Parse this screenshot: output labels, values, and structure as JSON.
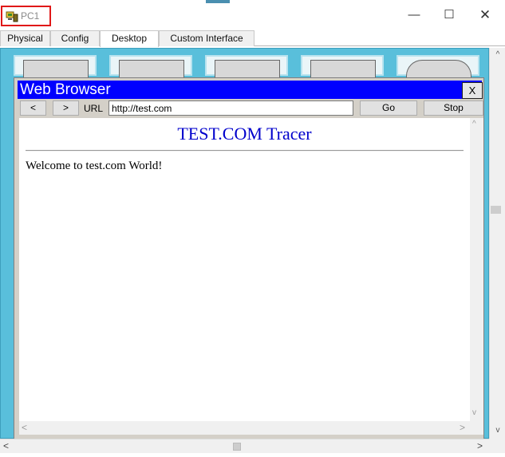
{
  "window": {
    "title": "PC1",
    "min_symbol": "—",
    "max_symbol": "☐",
    "close_symbol": "✕"
  },
  "tabs": [
    {
      "label": "Physical",
      "active": false
    },
    {
      "label": "Config",
      "active": false
    },
    {
      "label": "Desktop",
      "active": true
    },
    {
      "label": "Custom Interface",
      "active": false
    }
  ],
  "browser": {
    "title": "Web Browser",
    "close_label": "X",
    "back_label": "<",
    "forward_label": ">",
    "url_label": "URL",
    "url_value": "http://test.com",
    "go_label": "Go",
    "stop_label": "Stop",
    "page": {
      "heading": "TEST.COM Tracer",
      "body_text": "Welcome to test.com World!"
    }
  },
  "scroll": {
    "up": "^",
    "down": "v",
    "left": "<",
    "right": ">"
  },
  "colors": {
    "desktop_bg": "#59bfdb",
    "browser_titlebar": "#0000ff",
    "heading_color": "#0000cc",
    "highlight_box": "#e01818"
  },
  "icons": [
    "pc-icon",
    "minimize-icon",
    "maximize-icon",
    "close-icon"
  ]
}
